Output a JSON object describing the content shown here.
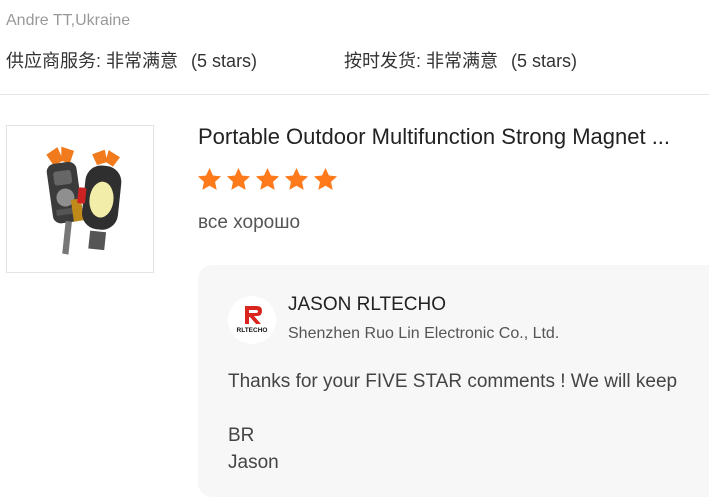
{
  "reviewer": "Andre TT,Ukraine",
  "ratings": [
    {
      "label": "供应商服务:",
      "value": "非常满意",
      "stars_text": "(5 stars)"
    },
    {
      "label": "按时发货:",
      "value": "非常满意",
      "stars_text": "(5 stars)"
    }
  ],
  "product": {
    "title": "Portable Outdoor Multifunction Strong Magnet ...",
    "rating": 5,
    "rating_max": 5,
    "comment": "все хорошо"
  },
  "reply": {
    "seller_name": "JASON RLTECHO",
    "company": "Shenzhen Ruo Lin Electronic Co., Ltd.",
    "logo_text": "RLTECHO",
    "lines": [
      "Thanks for your FIVE STAR comments ! We will keep",
      "",
      "BR",
      "Jason"
    ]
  },
  "colors": {
    "star": "#ff7a1a",
    "logo_red": "#d8261f",
    "reviewer_gray": "#999999"
  }
}
